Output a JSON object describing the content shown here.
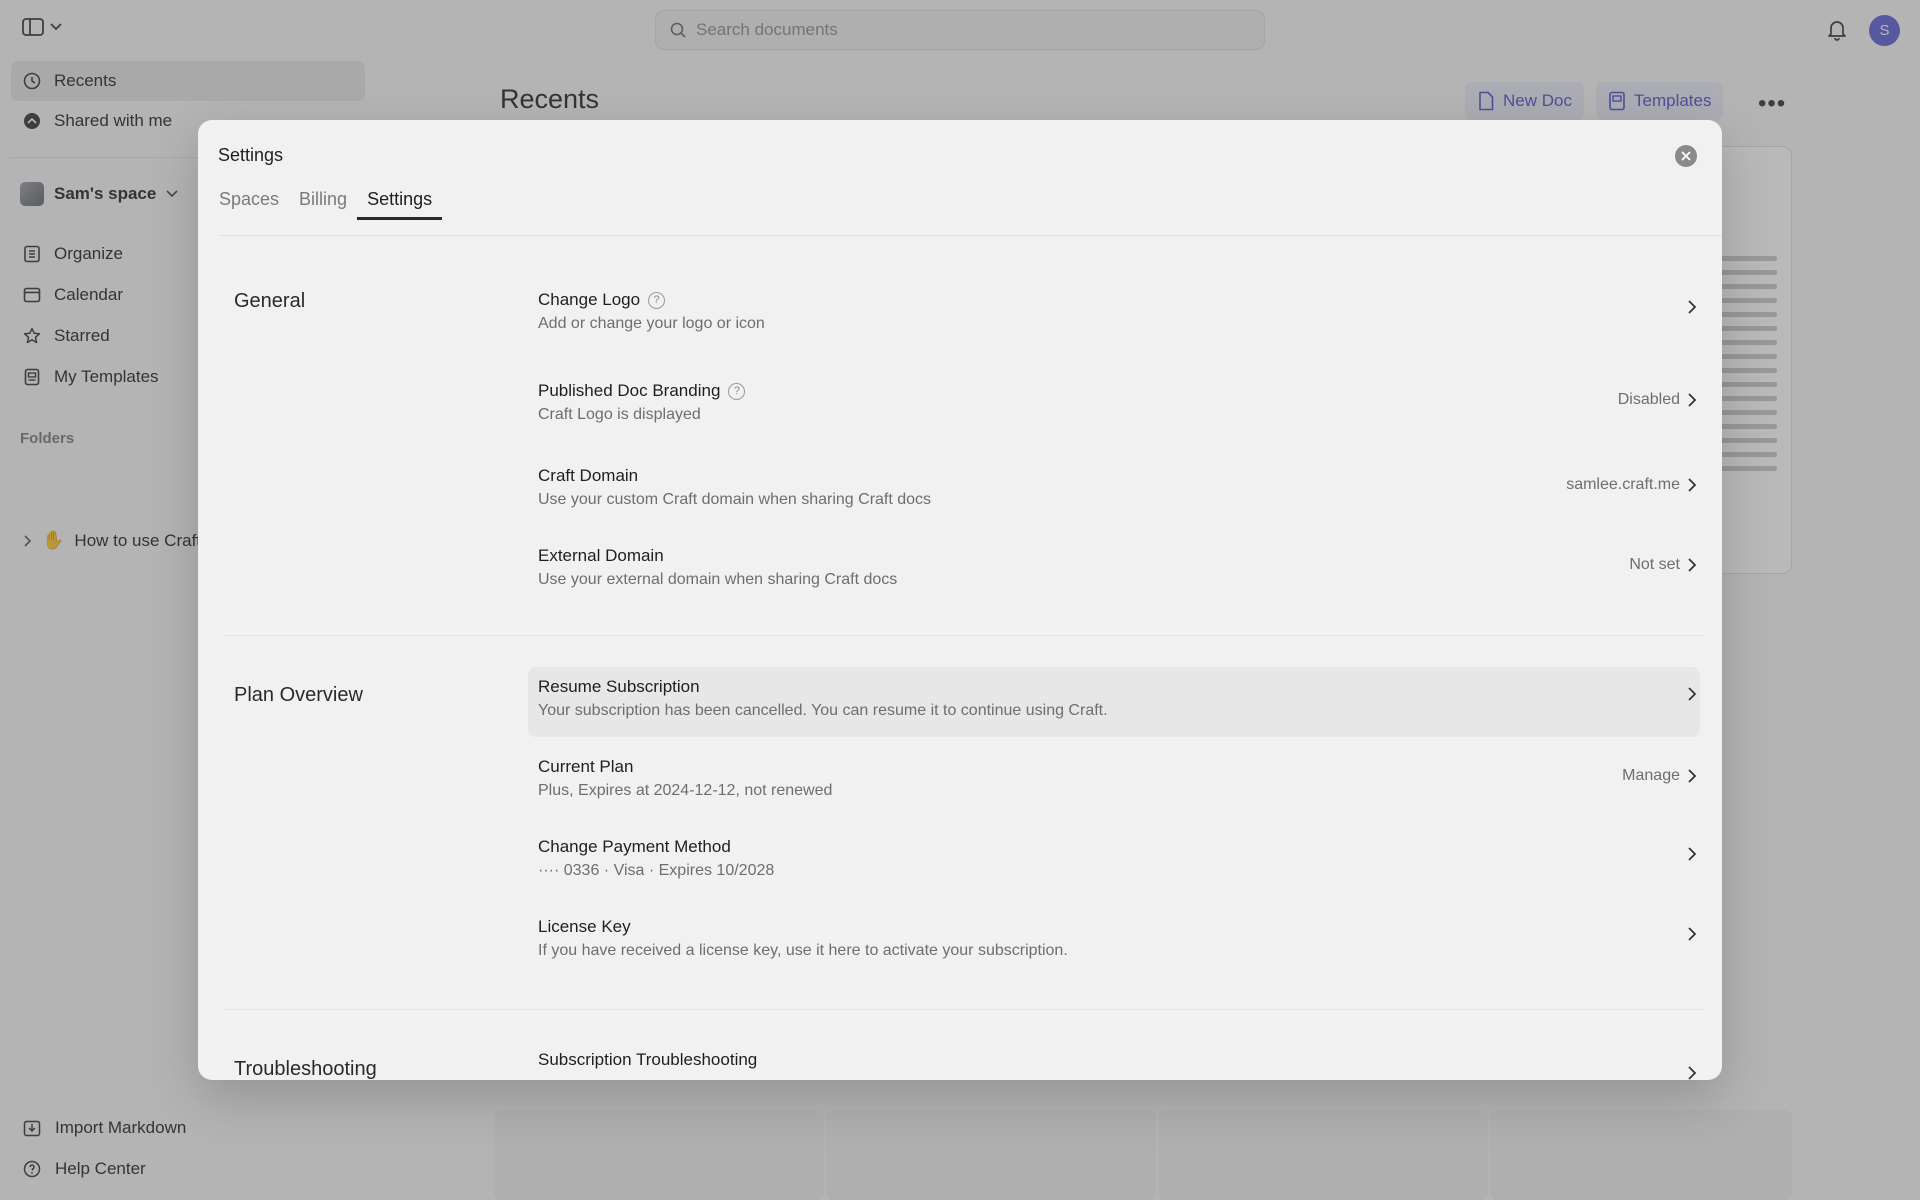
{
  "search": {
    "placeholder": "Search documents"
  },
  "user": {
    "avatar_letter": "S"
  },
  "sidebar": {
    "nav": [
      {
        "label": "Recents",
        "icon": "clock-icon"
      },
      {
        "label": "Shared with me",
        "icon": "shared-icon"
      }
    ],
    "space_name": "Sam's space",
    "items": [
      {
        "label": "Organize",
        "icon": "organize-icon"
      },
      {
        "label": "Calendar",
        "icon": "calendar-icon"
      },
      {
        "label": "Starred",
        "icon": "star-icon"
      },
      {
        "label": "My Templates",
        "icon": "templates-icon"
      }
    ],
    "folders_title": "Folders",
    "folder_item": "How to use Craft",
    "bottom": [
      {
        "label": "Import Markdown",
        "icon": "import-icon"
      },
      {
        "label": "Help Center",
        "icon": "help-icon"
      }
    ]
  },
  "main": {
    "title": "Recents",
    "new_doc_label": "New Doc",
    "templates_label": "Templates"
  },
  "modal": {
    "title": "Settings",
    "tabs": [
      "Spaces",
      "Billing",
      "Settings"
    ],
    "active_tab": "Settings",
    "sections": {
      "general": {
        "title": "General",
        "rows": [
          {
            "title": "Change Logo",
            "subtitle": "Add or change your logo or icon",
            "value": ""
          },
          {
            "title": "Published Doc Branding",
            "subtitle": "Craft Logo is displayed",
            "value": "Disabled"
          },
          {
            "title": "Craft Domain",
            "subtitle": "Use your custom Craft domain when sharing Craft docs",
            "value": "samlee.craft.me"
          },
          {
            "title": "External Domain",
            "subtitle": "Use your external domain when sharing Craft docs",
            "value": "Not set"
          }
        ]
      },
      "plan": {
        "title": "Plan Overview",
        "rows": [
          {
            "title": "Resume Subscription",
            "subtitle": "Your subscription has been cancelled. You can resume it to continue using Craft.",
            "value": ""
          },
          {
            "title": "Current Plan",
            "subtitle": "Plus, Expires at 2024-12-12, not renewed",
            "value": "Manage"
          },
          {
            "title": "Change Payment Method",
            "subtitle": "···· 0336 · Visa · Expires 10/2028",
            "value": ""
          },
          {
            "title": "License Key",
            "subtitle": "If you have received a license key, use it here to activate your subscription.",
            "value": ""
          }
        ]
      },
      "troubleshooting": {
        "title": "Troubleshooting",
        "rows": [
          {
            "title": "Subscription Troubleshooting",
            "subtitle": "",
            "value": ""
          }
        ]
      }
    }
  }
}
